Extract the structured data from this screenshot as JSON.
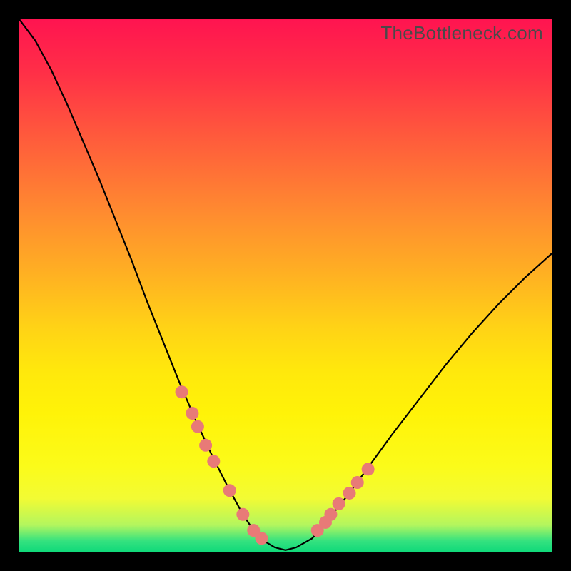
{
  "watermark": "TheBottleneck.com",
  "chart_data": {
    "type": "line",
    "title": "",
    "xlabel": "",
    "ylabel": "",
    "xlim": [
      0,
      100
    ],
    "ylim": [
      0,
      100
    ],
    "x": [
      0,
      3,
      6,
      9,
      12,
      15,
      18,
      21,
      24,
      27,
      30,
      33,
      36,
      39,
      42,
      44,
      46,
      48,
      50,
      52,
      55,
      58,
      62,
      66,
      70,
      75,
      80,
      85,
      90,
      95,
      100
    ],
    "values": [
      100,
      96,
      90.5,
      84,
      77,
      70,
      62.5,
      55,
      47,
      39.5,
      32,
      25,
      18.5,
      12.5,
      7,
      4,
      2,
      0.8,
      0.3,
      0.8,
      2.5,
      6,
      11,
      16.5,
      22,
      28.5,
      35,
      41,
      46.5,
      51.5,
      56
    ],
    "markers_left": {
      "x": [
        30.5,
        32.5,
        33.5,
        35,
        36.5,
        39.5,
        42,
        44,
        45.5
      ],
      "y": [
        30,
        26,
        23.5,
        20,
        17,
        11.5,
        7,
        4,
        2.5
      ]
    },
    "markers_right": {
      "x": [
        56,
        57.5,
        58.5,
        60,
        62,
        63.5,
        65.5
      ],
      "y": [
        4,
        5.5,
        7,
        9,
        11,
        13,
        15.5
      ]
    },
    "marker_color": "#e87a77",
    "line_color": "#000000"
  }
}
